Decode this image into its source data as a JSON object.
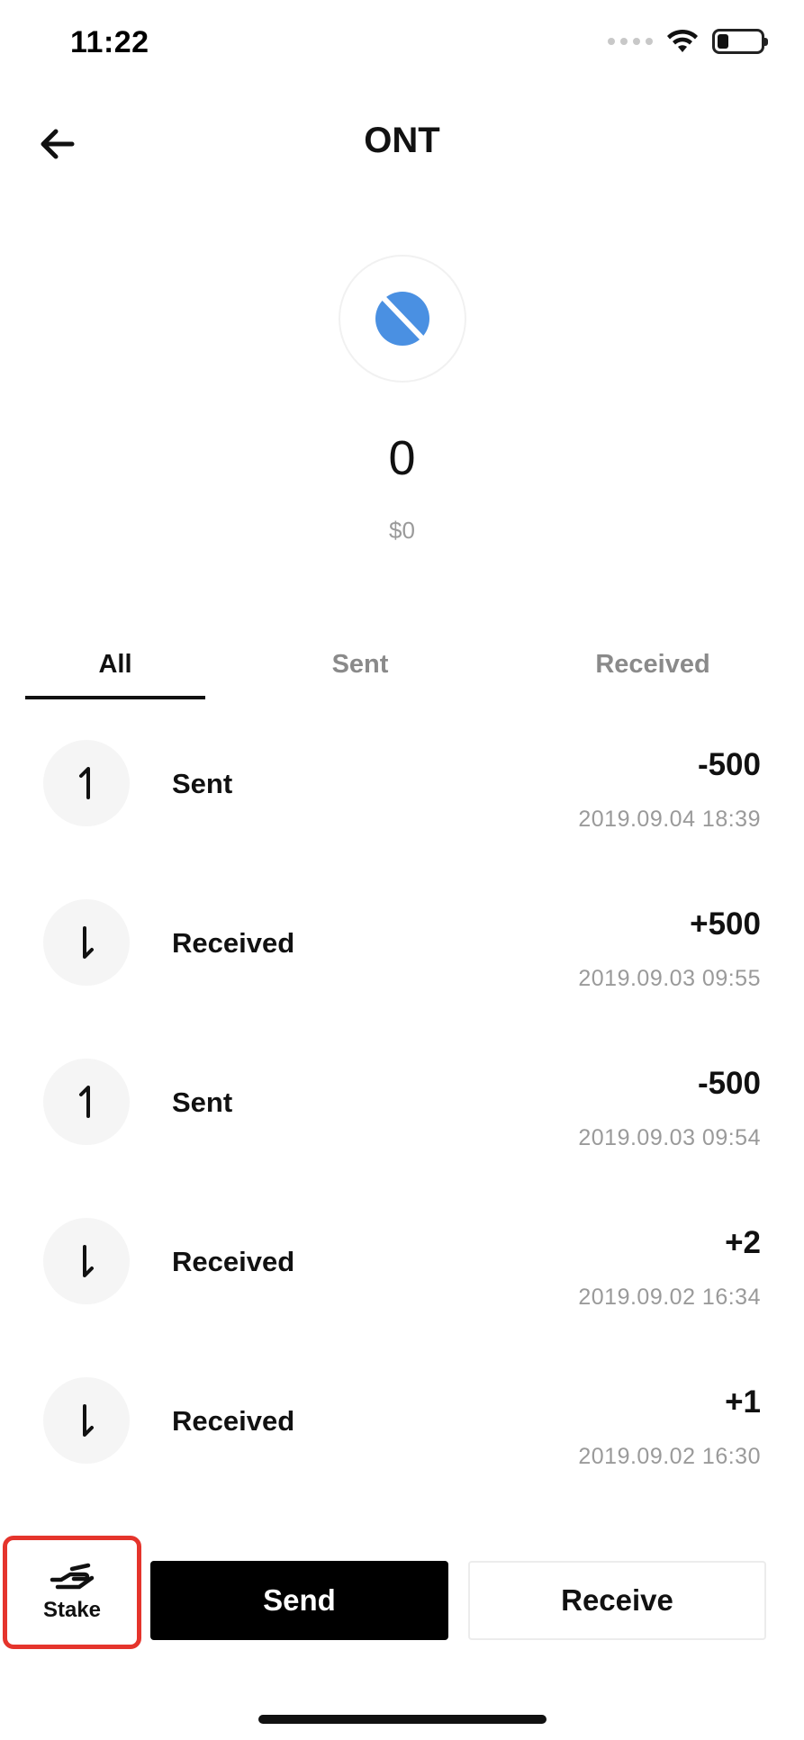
{
  "status_bar": {
    "time": "11:22",
    "battery_level": 0.25
  },
  "header": {
    "title": "ONT",
    "back_icon": "arrow-left-icon"
  },
  "token": {
    "logo_icon": "ontology-logo-icon",
    "logo_color": "#4a90e2",
    "balance": "0",
    "fiat_value": "$0"
  },
  "tabs": [
    {
      "label": "All",
      "active": true
    },
    {
      "label": "Sent",
      "active": false
    },
    {
      "label": "Received",
      "active": false
    }
  ],
  "transactions": [
    {
      "direction": "sent",
      "type": "Sent",
      "amount": "-500",
      "time": "2019.09.04 18:39"
    },
    {
      "direction": "received",
      "type": "Received",
      "amount": "+500",
      "time": "2019.09.03 09:55"
    },
    {
      "direction": "sent",
      "type": "Sent",
      "amount": "-500",
      "time": "2019.09.03 09:54"
    },
    {
      "direction": "received",
      "type": "Received",
      "amount": "+2",
      "time": "2019.09.02 16:34"
    },
    {
      "direction": "received",
      "type": "Received",
      "amount": "+1",
      "time": "2019.09.02 16:30"
    }
  ],
  "actions": {
    "stake_label": "Stake",
    "send_label": "Send",
    "receive_label": "Receive",
    "highlight_color": "#e5342c"
  }
}
